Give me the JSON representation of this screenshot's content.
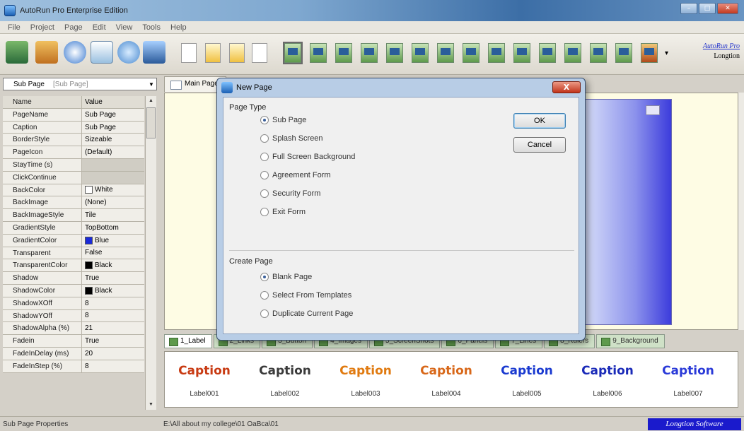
{
  "window": {
    "title": "AutoRun Pro Enterprise Edition"
  },
  "menu": [
    "File",
    "Project",
    "Page",
    "Edit",
    "View",
    "Tools",
    "Help"
  ],
  "toolbar": {
    "brand_link": "AutoRun Pro",
    "brand_sub": "Longtion"
  },
  "left_panel": {
    "page_name": "Sub Page",
    "page_type": "[Sub Page]",
    "columns": {
      "name": "Name",
      "value": "Value"
    },
    "properties": [
      {
        "name": "PageName",
        "value": "Sub Page"
      },
      {
        "name": "Caption",
        "value": "Sub Page"
      },
      {
        "name": "BorderStyle",
        "value": "Sizeable"
      },
      {
        "name": "PageIcon",
        "value": "(Default)"
      },
      {
        "name": "StayTime (s)",
        "value": ""
      },
      {
        "name": "ClickContinue",
        "value": ""
      },
      {
        "name": "BackColor",
        "value": "White"
      },
      {
        "name": "BackImage",
        "value": "(None)"
      },
      {
        "name": "BackImageStyle",
        "value": "Tile"
      },
      {
        "name": "GradientStyle",
        "value": "TopBottom"
      },
      {
        "name": "GradientColor",
        "value": "Blue"
      },
      {
        "name": "Transparent",
        "value": "False"
      },
      {
        "name": "TransparentColor",
        "value": "Black"
      },
      {
        "name": "Shadow",
        "value": "True"
      },
      {
        "name": "ShadowColor",
        "value": "Black"
      },
      {
        "name": "ShadowXOff",
        "value": "8"
      },
      {
        "name": "ShadowYOff",
        "value": "8"
      },
      {
        "name": "ShadowAlpha (%)",
        "value": "21"
      },
      {
        "name": "Fadein",
        "value": "True"
      },
      {
        "name": "FadeInDelay (ms)",
        "value": "20"
      },
      {
        "name": "FadeInStep (%)",
        "value": "8"
      }
    ],
    "colors": {
      "gradient": "#1a2ad8",
      "black": "#000000",
      "white": "#ffffff"
    }
  },
  "main_tabs": [
    "Main Page"
  ],
  "bottom_tabs": [
    "1_Label",
    "2_Links",
    "3_Button",
    "4_Images",
    "5_ScreenShots",
    "6_Panels",
    "7_Lines",
    "8_Rulers",
    "9_Background"
  ],
  "captions": [
    {
      "art": "Caption",
      "label": "Label001",
      "color": "#c83a12"
    },
    {
      "art": "Caption",
      "label": "Label002",
      "color": "#3a3a3a"
    },
    {
      "art": "Caption",
      "label": "Label003",
      "color": "#e07a10"
    },
    {
      "art": "Caption",
      "label": "Label004",
      "color": "#d8681a"
    },
    {
      "art": "Caption",
      "label": "Label005",
      "color": "#1a3ad0"
    },
    {
      "art": "Caption",
      "label": "Label006",
      "color": "#1a2ab8"
    },
    {
      "art": "Caption",
      "label": "Label007",
      "color": "#2a3ad8"
    }
  ],
  "status": {
    "left": "Sub Page Properties",
    "path": "E:\\All about my college\\01 OaBca\\01",
    "brand": "Longtion Software"
  },
  "dialog": {
    "title": "New Page",
    "close": "X",
    "page_type_label": "Page Type",
    "page_types": [
      {
        "label": "Sub Page",
        "checked": true
      },
      {
        "label": "Splash Screen",
        "checked": false
      },
      {
        "label": "Full Screen Background",
        "checked": false
      },
      {
        "label": "Agreement Form",
        "checked": false
      },
      {
        "label": "Security Form",
        "checked": false
      },
      {
        "label": "Exit Form",
        "checked": false
      }
    ],
    "create_page_label": "Create Page",
    "create_options": [
      {
        "label": "Blank Page",
        "checked": true
      },
      {
        "label": "Select From Templates",
        "checked": false
      },
      {
        "label": "Duplicate Current Page",
        "checked": false
      }
    ],
    "ok": "OK",
    "cancel": "Cancel"
  }
}
